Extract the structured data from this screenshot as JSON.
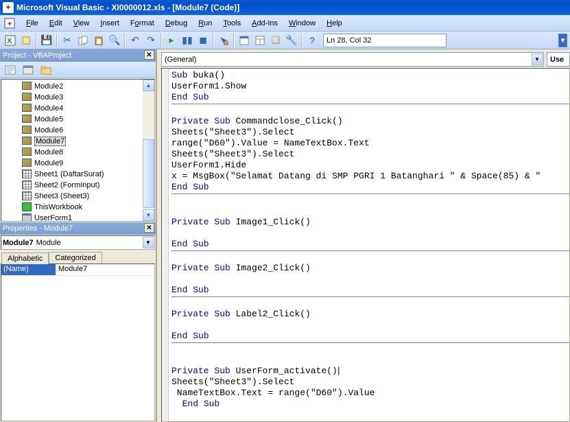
{
  "titlebar": {
    "text": "Microsoft Visual Basic - XI0000012.xls - [Module7 (Code)]"
  },
  "menu": {
    "file": "File",
    "edit": "Edit",
    "view": "View",
    "insert": "Insert",
    "format": "Format",
    "debug": "Debug",
    "run": "Run",
    "tools": "Tools",
    "addins": "Add-Ins",
    "window": "Window",
    "help": "Help"
  },
  "toolbar": {
    "position": "Ln 28, Col 32"
  },
  "project": {
    "title": "Project - VBAProject",
    "items": [
      {
        "type": "mod",
        "label": "Module2"
      },
      {
        "type": "mod",
        "label": "Module3"
      },
      {
        "type": "mod",
        "label": "Module4"
      },
      {
        "type": "mod",
        "label": "Module5"
      },
      {
        "type": "mod",
        "label": "Module6"
      },
      {
        "type": "mod",
        "label": "Module7",
        "selected": true
      },
      {
        "type": "mod",
        "label": "Module8"
      },
      {
        "type": "mod",
        "label": "Module9"
      },
      {
        "type": "sheet",
        "label": "Sheet1 (DaftarSurat)"
      },
      {
        "type": "sheet",
        "label": "Sheet2 (FormInput)"
      },
      {
        "type": "sheet",
        "label": "Sheet3 (Sheet3)"
      },
      {
        "type": "wb",
        "label": "ThisWorkbook"
      },
      {
        "type": "form",
        "label": "UserForm1"
      }
    ]
  },
  "properties": {
    "title": "Properties - Module7",
    "object_name": "Module7",
    "object_type": "Module",
    "tabs": {
      "alphabetic": "Alphabetic",
      "categorized": "Categorized"
    },
    "rows": [
      {
        "name": "(Name)",
        "value": "Module7"
      }
    ]
  },
  "codepane": {
    "left_combo": "(General)",
    "right_combo": "Use",
    "lines": [
      {
        "t": "Sub",
        "k": true
      },
      {
        "t": " buka()"
      },
      "\n",
      {
        "t": "UserForm1.Show"
      },
      "\n",
      {
        "t": "End Sub",
        "k": true
      },
      "HR",
      "\n",
      {
        "t": "Private Sub",
        "k": true
      },
      {
        "t": " Commandclose_Click()"
      },
      "\n",
      {
        "t": "Sheets(\"Sheet3\").Select"
      },
      "\n",
      {
        "t": "range(\"D60\").Value = NameTextBox.Text"
      },
      "\n",
      {
        "t": "Sheets(\"Sheet3\").Select"
      },
      "\n",
      {
        "t": "UserForm1.Hide"
      },
      "\n",
      {
        "t": "x = MsgBox(\"Selamat Datang di SMP PGRI 1 Batanghari \" & Space(85) & \""
      },
      "\n",
      {
        "t": "End Sub",
        "k": true
      },
      "HR",
      "\n",
      "\n",
      {
        "t": "Private Sub",
        "k": true
      },
      {
        "t": " Image1_Click()"
      },
      "\n",
      "\n",
      {
        "t": "End Sub",
        "k": true
      },
      "HR",
      "\n",
      {
        "t": "Private Sub",
        "k": true
      },
      {
        "t": " Image2_Click()"
      },
      "\n",
      "\n",
      {
        "t": "End Sub",
        "k": true
      },
      "HR",
      "\n",
      {
        "t": "Private Sub",
        "k": true
      },
      {
        "t": " Label2_Click()"
      },
      "\n",
      "\n",
      {
        "t": "End Sub",
        "k": true
      },
      "HR",
      "\n",
      "\n",
      {
        "t": "Private Sub",
        "k": true
      },
      {
        "t": " UserForm_activate()",
        "cursor": true
      },
      "\n",
      {
        "t": "Sheets(\"Sheet3\").Select"
      },
      "\n",
      {
        "t": " NameTextBox.Text = range(\"D60\").Value"
      },
      "\n",
      {
        "t": "  "
      },
      {
        "t": "End Sub",
        "k": true
      }
    ]
  }
}
